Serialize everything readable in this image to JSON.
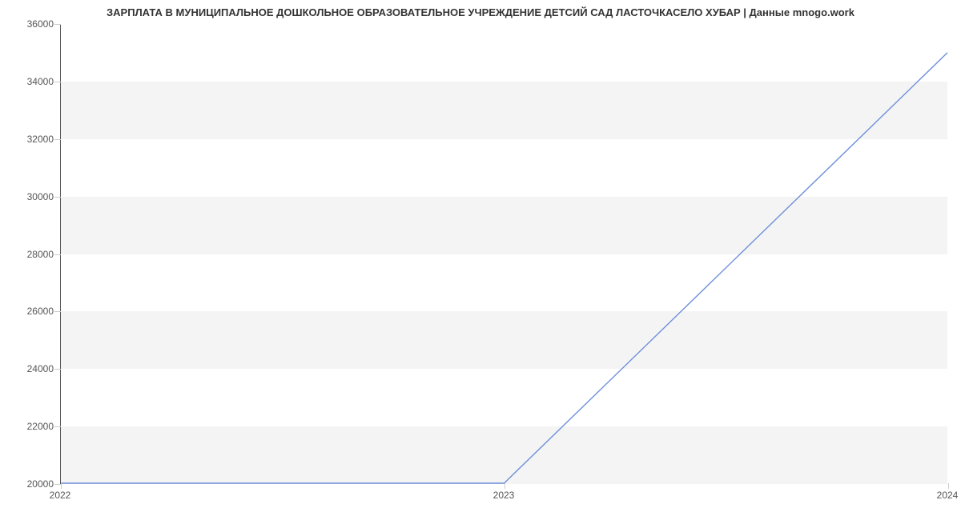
{
  "chart_data": {
    "type": "line",
    "title": "ЗАРПЛАТА В МУНИЦИПАЛЬНОЕ ДОШКОЛЬНОЕ ОБРАЗОВАТЕЛЬНОЕ УЧРЕЖДЕНИЕ ДЕТСИЙ САД ЛАСТОЧКАСЕЛО ХУБАР | Данные mnogo.work",
    "xlabel": "",
    "ylabel": "",
    "x": [
      2022,
      2023,
      2024
    ],
    "values": [
      20000,
      20000,
      35000
    ],
    "x_ticks": [
      2022,
      2023,
      2024
    ],
    "y_ticks": [
      20000,
      22000,
      24000,
      26000,
      28000,
      30000,
      32000,
      34000,
      36000
    ],
    "ylim": [
      20000,
      36000
    ],
    "xlim": [
      2022,
      2024
    ],
    "line_color": "#6e8fd9"
  }
}
